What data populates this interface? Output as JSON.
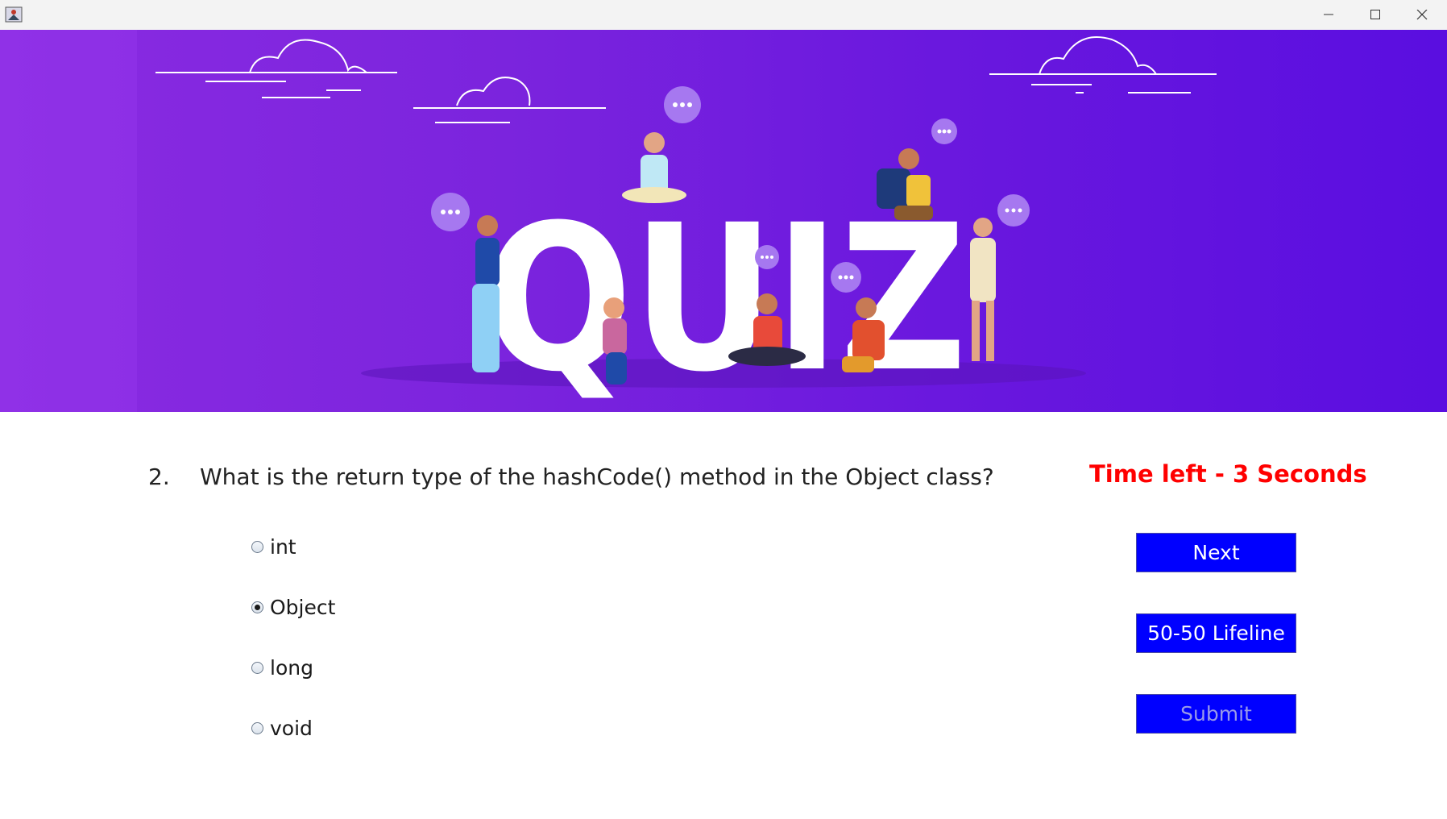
{
  "window": {
    "icons": {
      "app": "java-app-icon",
      "minimize": "minimize-icon",
      "maximize": "maximize-icon",
      "close": "close-icon"
    }
  },
  "banner": {
    "heading": "QUIZ",
    "colors": {
      "from": "#8a2be2",
      "to": "#5a0ee0",
      "text": "#ffffff"
    }
  },
  "question": {
    "number": "2.",
    "text": "What is the return type of the hashCode() method in the Object class?"
  },
  "timer": {
    "text": "Time left - 3 Seconds",
    "color": "#ff0000"
  },
  "options": [
    {
      "label": "int",
      "selected": false
    },
    {
      "label": "Object",
      "selected": true
    },
    {
      "label": "long",
      "selected": false
    },
    {
      "label": "void",
      "selected": false
    }
  ],
  "buttons": {
    "next": "Next",
    "lifeline": "50-50 Lifeline",
    "submit": "Submit",
    "submit_enabled": false,
    "color": "#0000ff"
  }
}
